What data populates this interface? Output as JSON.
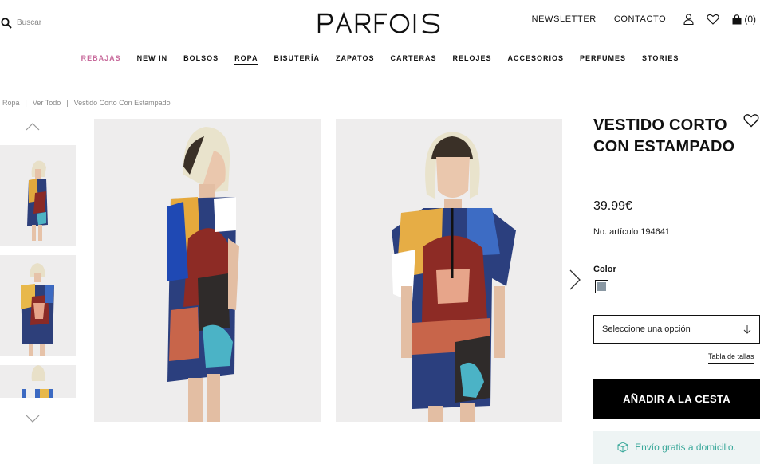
{
  "header": {
    "search_placeholder": "Buscar",
    "logo": "PARFOIS",
    "newsletter": "NEWSLETTER",
    "contact": "CONTACTO",
    "cart_count": "(0)"
  },
  "nav": [
    {
      "label": "REBAJAS",
      "state": "sale"
    },
    {
      "label": "NEW IN",
      "state": ""
    },
    {
      "label": "BOLSOS",
      "state": ""
    },
    {
      "label": "ROPA",
      "state": "active"
    },
    {
      "label": "BISUTERÍA",
      "state": ""
    },
    {
      "label": "ZAPATOS",
      "state": ""
    },
    {
      "label": "CARTERAS",
      "state": ""
    },
    {
      "label": "RELOJES",
      "state": ""
    },
    {
      "label": "ACCESORIOS",
      "state": ""
    },
    {
      "label": "PERFUMES",
      "state": ""
    },
    {
      "label": "STORIES",
      "state": ""
    }
  ],
  "breadcrumb": [
    "Ropa",
    "Ver Todo",
    "Vestido Corto Con Estampado"
  ],
  "breadcrumb_sep": "|",
  "product": {
    "title": "VESTIDO CORTO CON ESTAMPADO",
    "price": "39.99€",
    "article": "No. artículo 194641",
    "color_label": "Color",
    "swatch_color": "#8a98a3",
    "size_placeholder": "Seleccione una opción",
    "size_guide": "Tabla de tallas",
    "add_to_cart": "AÑADIR A LA CESTA",
    "shipping": "Envío gratis a domicilio."
  },
  "colors": {
    "sale": "#c86b9c",
    "accent_green": "#3aa89a",
    "image_bg": "#eeeded"
  },
  "icons": [
    "search-icon",
    "user-icon",
    "heart-icon",
    "bag-icon",
    "chevron-up-icon",
    "chevron-down-icon",
    "chevron-right-icon",
    "box-icon"
  ]
}
